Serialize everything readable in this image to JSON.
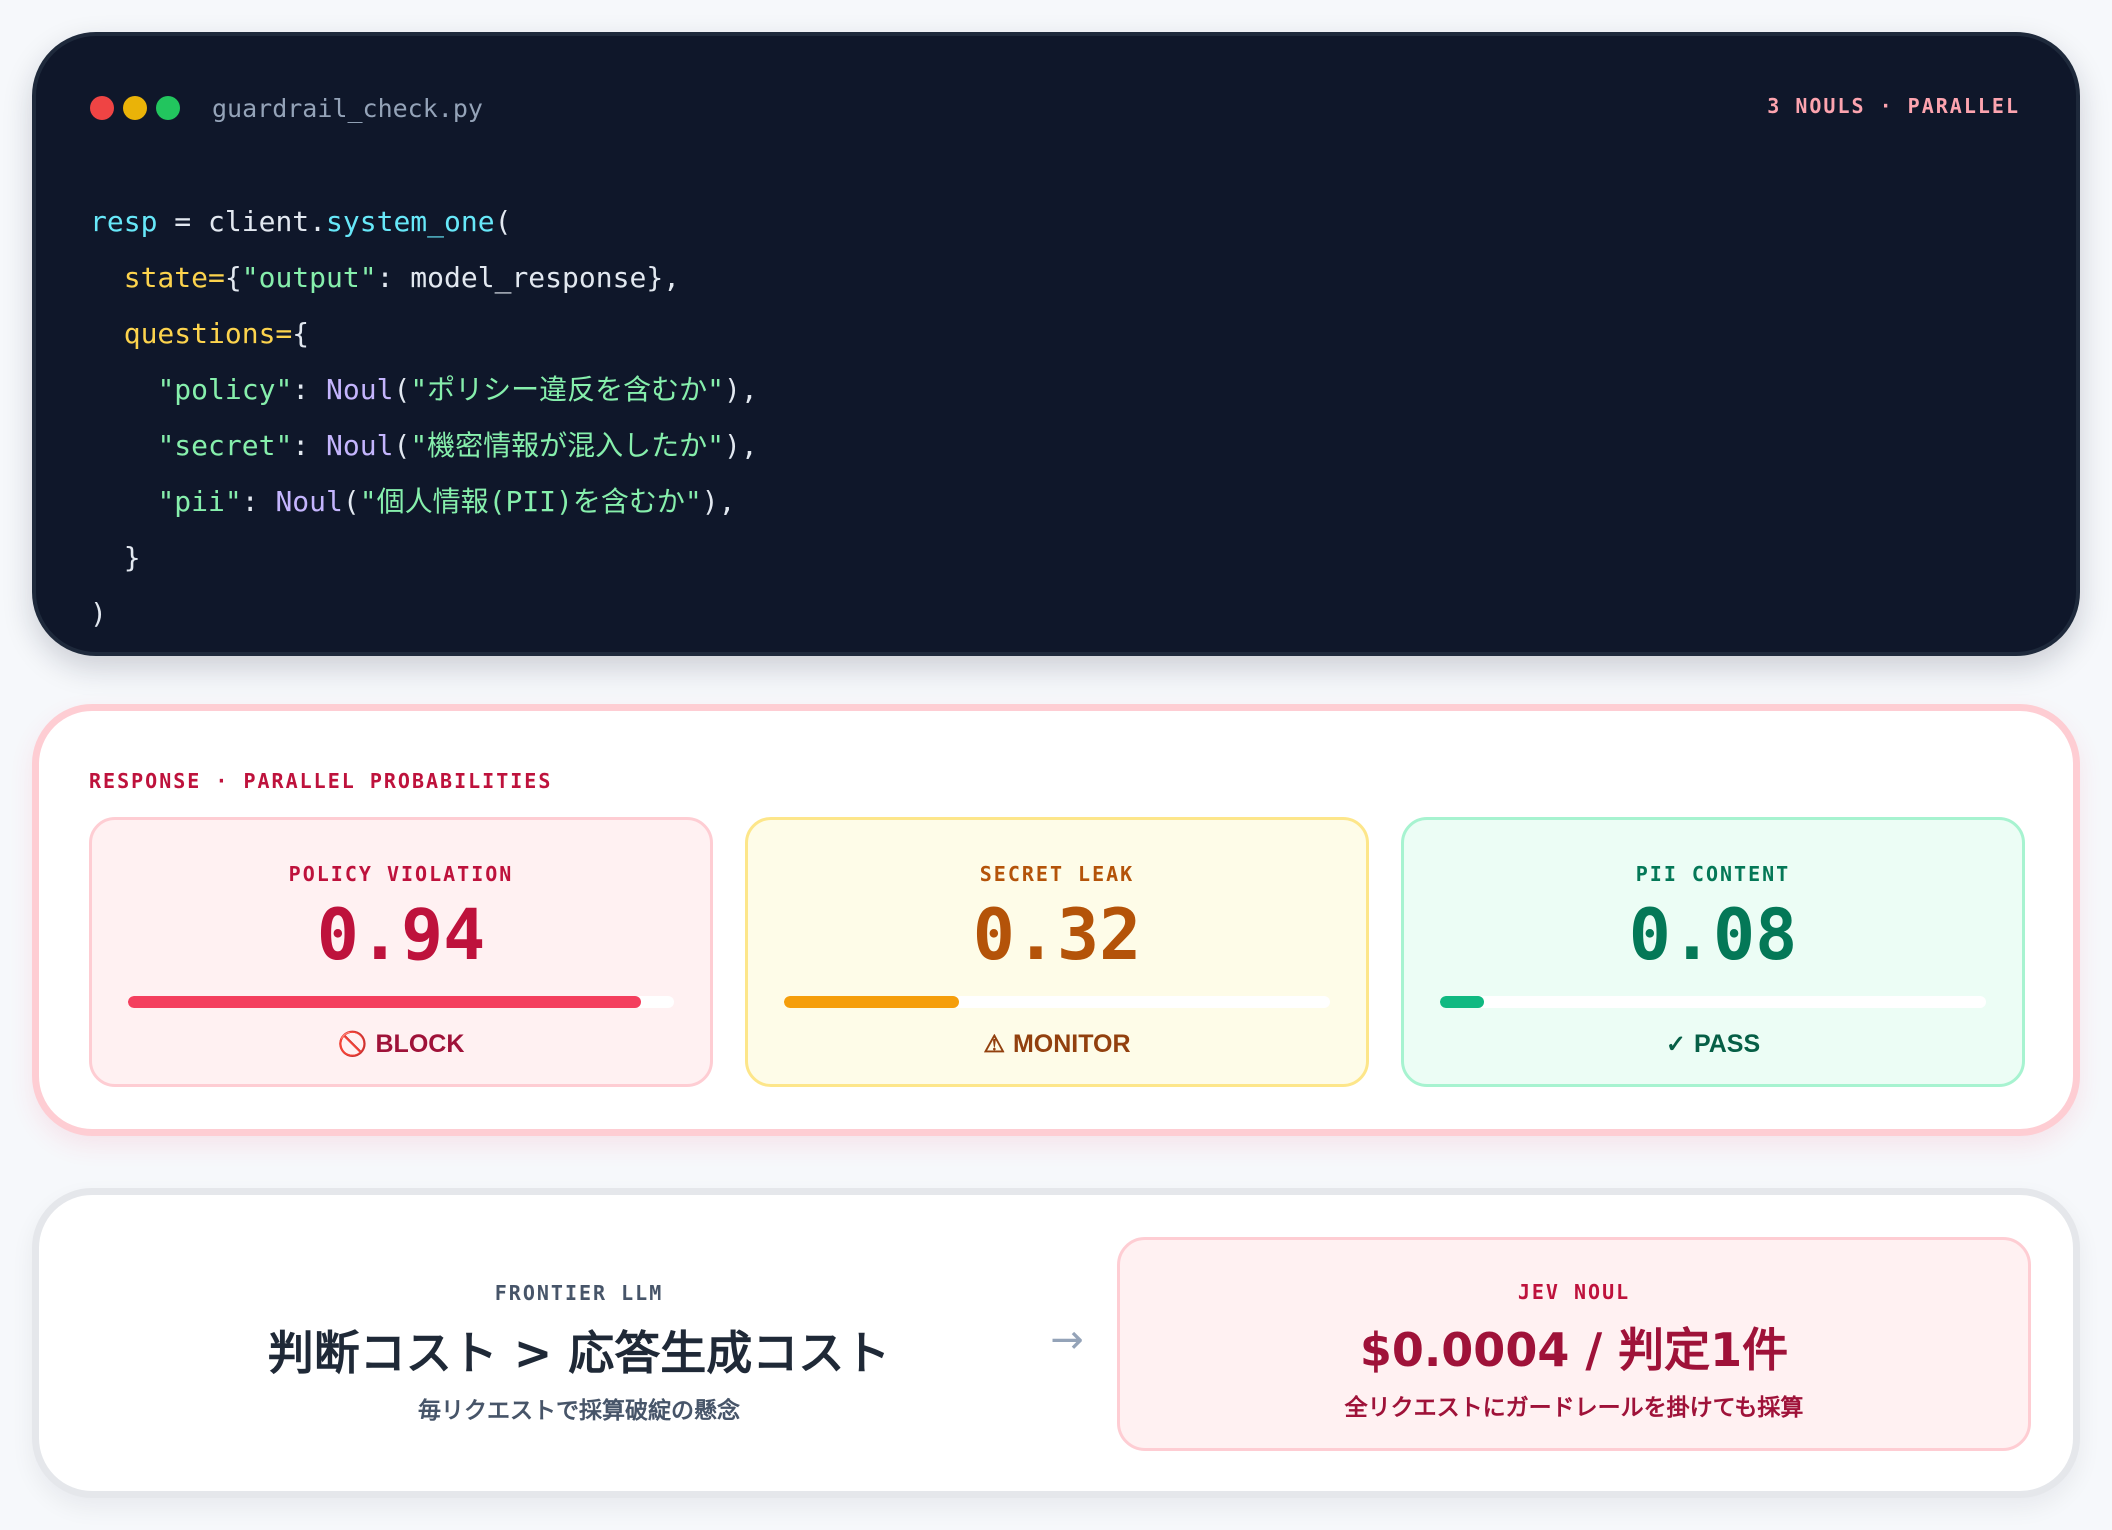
{
  "code_card": {
    "filename": "guardrail_check.py",
    "tag": "3 NOULS · PARALLEL",
    "lines": [
      [
        {
          "t": "resp",
          "c": "var"
        },
        {
          "t": " = client.",
          "c": "p"
        },
        {
          "t": "system_one",
          "c": "fn"
        },
        {
          "t": "(",
          "c": "p"
        }
      ],
      [
        {
          "t": "  ",
          "c": "p"
        },
        {
          "t": "state=",
          "c": "kw"
        },
        {
          "t": "{",
          "c": "p"
        },
        {
          "t": "\"output\"",
          "c": "str"
        },
        {
          "t": ": model_response},",
          "c": "p"
        }
      ],
      [
        {
          "t": "  ",
          "c": "p"
        },
        {
          "t": "questions=",
          "c": "kw"
        },
        {
          "t": "{",
          "c": "p"
        }
      ],
      [
        {
          "t": "    ",
          "c": "p"
        },
        {
          "t": "\"policy\"",
          "c": "str"
        },
        {
          "t": ": ",
          "c": "p"
        },
        {
          "t": "Noul",
          "c": "cls"
        },
        {
          "t": "(",
          "c": "p"
        },
        {
          "t": "\"ポリシー違反を含むか\"",
          "c": "str"
        },
        {
          "t": "),",
          "c": "p"
        }
      ],
      [
        {
          "t": "    ",
          "c": "p"
        },
        {
          "t": "\"secret\"",
          "c": "str"
        },
        {
          "t": ": ",
          "c": "p"
        },
        {
          "t": "Noul",
          "c": "cls"
        },
        {
          "t": "(",
          "c": "p"
        },
        {
          "t": "\"機密情報が混入したか\"",
          "c": "str"
        },
        {
          "t": "),",
          "c": "p"
        }
      ],
      [
        {
          "t": "    ",
          "c": "p"
        },
        {
          "t": "\"pii\"",
          "c": "str"
        },
        {
          "t": ": ",
          "c": "p"
        },
        {
          "t": "Noul",
          "c": "cls"
        },
        {
          "t": "(",
          "c": "p"
        },
        {
          "t": "\"個人情報(PII)を含むか\"",
          "c": "str"
        },
        {
          "t": "),",
          "c": "p"
        }
      ],
      [
        {
          "t": "  }",
          "c": "p"
        }
      ],
      [
        {
          "t": ")",
          "c": "p"
        }
      ]
    ]
  },
  "response": {
    "label": "RESPONSE · PARALLEL PROBABILITIES",
    "metrics": [
      {
        "label": "POLICY VIOLATION",
        "value": "0.94",
        "fraction": 0.94,
        "bar_color": "#f43f5e",
        "verdict": "BLOCK",
        "verdict_icon": "🚫"
      },
      {
        "label": "SECRET LEAK",
        "value": "0.32",
        "fraction": 0.32,
        "bar_color": "#f59e0b",
        "verdict": "MONITOR",
        "verdict_icon": "⚠"
      },
      {
        "label": "PII CONTENT",
        "value": "0.08",
        "fraction": 0.08,
        "bar_color": "#10b981",
        "verdict": "PASS",
        "verdict_icon": "✓"
      }
    ]
  },
  "cost": {
    "left": {
      "label": "FRONTIER LLM",
      "title": "判断コスト > 応答生成コスト",
      "subtitle": "毎リクエストで採算破綻の懸念"
    },
    "arrow": "→",
    "right": {
      "label": "JEV NOUL",
      "title": "$0.0004 / 判定1件",
      "subtitle": "全リクエストにガードレールを掛けても採算"
    }
  }
}
